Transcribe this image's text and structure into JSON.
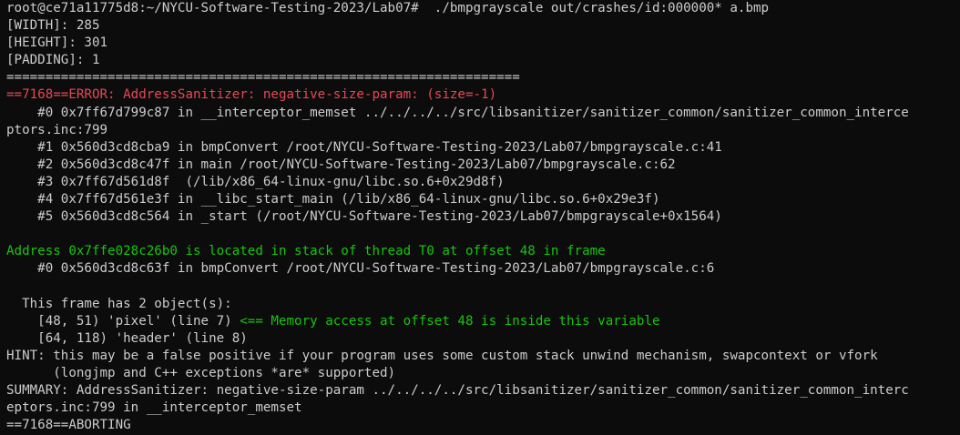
{
  "terminal": {
    "colors": {
      "background": "#0c0c0c",
      "foreground": "#cccccc",
      "error_red": "#e74856",
      "info_green": "#16c60c"
    },
    "prompt": "root@ce71a11775d8:~/NYCU-Software-Testing-2023/Lab07#",
    "command": "  ./bmpgrayscale out/crashes/id:000000* a.bmp",
    "program_output": [
      "[WIDTH]: 285",
      "[HEIGHT]: 301",
      "[PADDING]: 1",
      "=================================================================="
    ],
    "asan_error": "==7168==ERROR: AddressSanitizer: negative-size-param: (size=-1)",
    "stack_trace": [
      "    #0 0x7ff67d799c87 in __interceptor_memset ../../../../src/libsanitizer/sanitizer_common/sanitizer_common_interce",
      "ptors.inc:799",
      "    #1 0x560d3cd8cba9 in bmpConvert /root/NYCU-Software-Testing-2023/Lab07/bmpgrayscale.c:41",
      "    #2 0x560d3cd8c47f in main /root/NYCU-Software-Testing-2023/Lab07/bmpgrayscale.c:62",
      "    #3 0x7ff67d561d8f  (/lib/x86_64-linux-gnu/libc.so.6+0x29d8f)",
      "    #4 0x7ff67d561e3f in __libc_start_main (/lib/x86_64-linux-gnu/libc.so.6+0x29e3f)",
      "    #5 0x560d3cd8c564 in _start (/root/NYCU-Software-Testing-2023/Lab07/bmpgrayscale+0x1564)"
    ],
    "blank_1": "",
    "address_info": "Address 0x7ffe028c26b0 is located in stack of thread T0 at offset 48 in frame",
    "frame_line": "    #0 0x560d3cd8c63f in bmpConvert /root/NYCU-Software-Testing-2023/Lab07/bmpgrayscale.c:6",
    "blank_2": "",
    "frame_objects_header": "  This frame has 2 object(s):",
    "object_pixel": "    [48, 51) 'pixel' (line 7)",
    "object_pixel_note": " <== Memory access at offset 48 is inside this variable",
    "object_header": "    [64, 118) 'header' (line 8)",
    "hint": [
      "HINT: this may be a false positive if your program uses some custom stack unwind mechanism, swapcontext or vfork",
      "      (longjmp and C++ exceptions *are* supported)"
    ],
    "summary": [
      "SUMMARY: AddressSanitizer: negative-size-param ../../../../src/libsanitizer/sanitizer_common/sanitizer_common_interc",
      "eptors.inc:799 in __interceptor_memset"
    ],
    "aborting": "==7168==ABORTING"
  }
}
